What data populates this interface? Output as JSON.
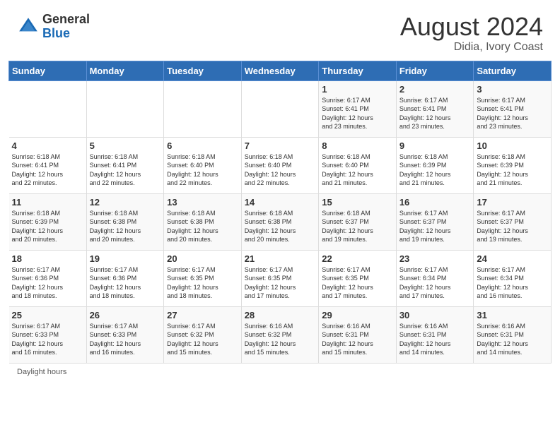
{
  "header": {
    "logo_general": "General",
    "logo_blue": "Blue",
    "title": "August 2024",
    "subtitle": "Didia, Ivory Coast"
  },
  "days_of_week": [
    "Sunday",
    "Monday",
    "Tuesday",
    "Wednesday",
    "Thursday",
    "Friday",
    "Saturday"
  ],
  "footer": {
    "daylight_label": "Daylight hours"
  },
  "weeks": [
    [
      {
        "day": "",
        "info": ""
      },
      {
        "day": "",
        "info": ""
      },
      {
        "day": "",
        "info": ""
      },
      {
        "day": "",
        "info": ""
      },
      {
        "day": "1",
        "info": "Sunrise: 6:17 AM\nSunset: 6:41 PM\nDaylight: 12 hours\nand 23 minutes."
      },
      {
        "day": "2",
        "info": "Sunrise: 6:17 AM\nSunset: 6:41 PM\nDaylight: 12 hours\nand 23 minutes."
      },
      {
        "day": "3",
        "info": "Sunrise: 6:17 AM\nSunset: 6:41 PM\nDaylight: 12 hours\nand 23 minutes."
      }
    ],
    [
      {
        "day": "4",
        "info": "Sunrise: 6:18 AM\nSunset: 6:41 PM\nDaylight: 12 hours\nand 22 minutes."
      },
      {
        "day": "5",
        "info": "Sunrise: 6:18 AM\nSunset: 6:41 PM\nDaylight: 12 hours\nand 22 minutes."
      },
      {
        "day": "6",
        "info": "Sunrise: 6:18 AM\nSunset: 6:40 PM\nDaylight: 12 hours\nand 22 minutes."
      },
      {
        "day": "7",
        "info": "Sunrise: 6:18 AM\nSunset: 6:40 PM\nDaylight: 12 hours\nand 22 minutes."
      },
      {
        "day": "8",
        "info": "Sunrise: 6:18 AM\nSunset: 6:40 PM\nDaylight: 12 hours\nand 21 minutes."
      },
      {
        "day": "9",
        "info": "Sunrise: 6:18 AM\nSunset: 6:39 PM\nDaylight: 12 hours\nand 21 minutes."
      },
      {
        "day": "10",
        "info": "Sunrise: 6:18 AM\nSunset: 6:39 PM\nDaylight: 12 hours\nand 21 minutes."
      }
    ],
    [
      {
        "day": "11",
        "info": "Sunrise: 6:18 AM\nSunset: 6:39 PM\nDaylight: 12 hours\nand 20 minutes."
      },
      {
        "day": "12",
        "info": "Sunrise: 6:18 AM\nSunset: 6:38 PM\nDaylight: 12 hours\nand 20 minutes."
      },
      {
        "day": "13",
        "info": "Sunrise: 6:18 AM\nSunset: 6:38 PM\nDaylight: 12 hours\nand 20 minutes."
      },
      {
        "day": "14",
        "info": "Sunrise: 6:18 AM\nSunset: 6:38 PM\nDaylight: 12 hours\nand 20 minutes."
      },
      {
        "day": "15",
        "info": "Sunrise: 6:18 AM\nSunset: 6:37 PM\nDaylight: 12 hours\nand 19 minutes."
      },
      {
        "day": "16",
        "info": "Sunrise: 6:17 AM\nSunset: 6:37 PM\nDaylight: 12 hours\nand 19 minutes."
      },
      {
        "day": "17",
        "info": "Sunrise: 6:17 AM\nSunset: 6:37 PM\nDaylight: 12 hours\nand 19 minutes."
      }
    ],
    [
      {
        "day": "18",
        "info": "Sunrise: 6:17 AM\nSunset: 6:36 PM\nDaylight: 12 hours\nand 18 minutes."
      },
      {
        "day": "19",
        "info": "Sunrise: 6:17 AM\nSunset: 6:36 PM\nDaylight: 12 hours\nand 18 minutes."
      },
      {
        "day": "20",
        "info": "Sunrise: 6:17 AM\nSunset: 6:35 PM\nDaylight: 12 hours\nand 18 minutes."
      },
      {
        "day": "21",
        "info": "Sunrise: 6:17 AM\nSunset: 6:35 PM\nDaylight: 12 hours\nand 17 minutes."
      },
      {
        "day": "22",
        "info": "Sunrise: 6:17 AM\nSunset: 6:35 PM\nDaylight: 12 hours\nand 17 minutes."
      },
      {
        "day": "23",
        "info": "Sunrise: 6:17 AM\nSunset: 6:34 PM\nDaylight: 12 hours\nand 17 minutes."
      },
      {
        "day": "24",
        "info": "Sunrise: 6:17 AM\nSunset: 6:34 PM\nDaylight: 12 hours\nand 16 minutes."
      }
    ],
    [
      {
        "day": "25",
        "info": "Sunrise: 6:17 AM\nSunset: 6:33 PM\nDaylight: 12 hours\nand 16 minutes."
      },
      {
        "day": "26",
        "info": "Sunrise: 6:17 AM\nSunset: 6:33 PM\nDaylight: 12 hours\nand 16 minutes."
      },
      {
        "day": "27",
        "info": "Sunrise: 6:17 AM\nSunset: 6:32 PM\nDaylight: 12 hours\nand 15 minutes."
      },
      {
        "day": "28",
        "info": "Sunrise: 6:16 AM\nSunset: 6:32 PM\nDaylight: 12 hours\nand 15 minutes."
      },
      {
        "day": "29",
        "info": "Sunrise: 6:16 AM\nSunset: 6:31 PM\nDaylight: 12 hours\nand 15 minutes."
      },
      {
        "day": "30",
        "info": "Sunrise: 6:16 AM\nSunset: 6:31 PM\nDaylight: 12 hours\nand 14 minutes."
      },
      {
        "day": "31",
        "info": "Sunrise: 6:16 AM\nSunset: 6:31 PM\nDaylight: 12 hours\nand 14 minutes."
      }
    ]
  ]
}
